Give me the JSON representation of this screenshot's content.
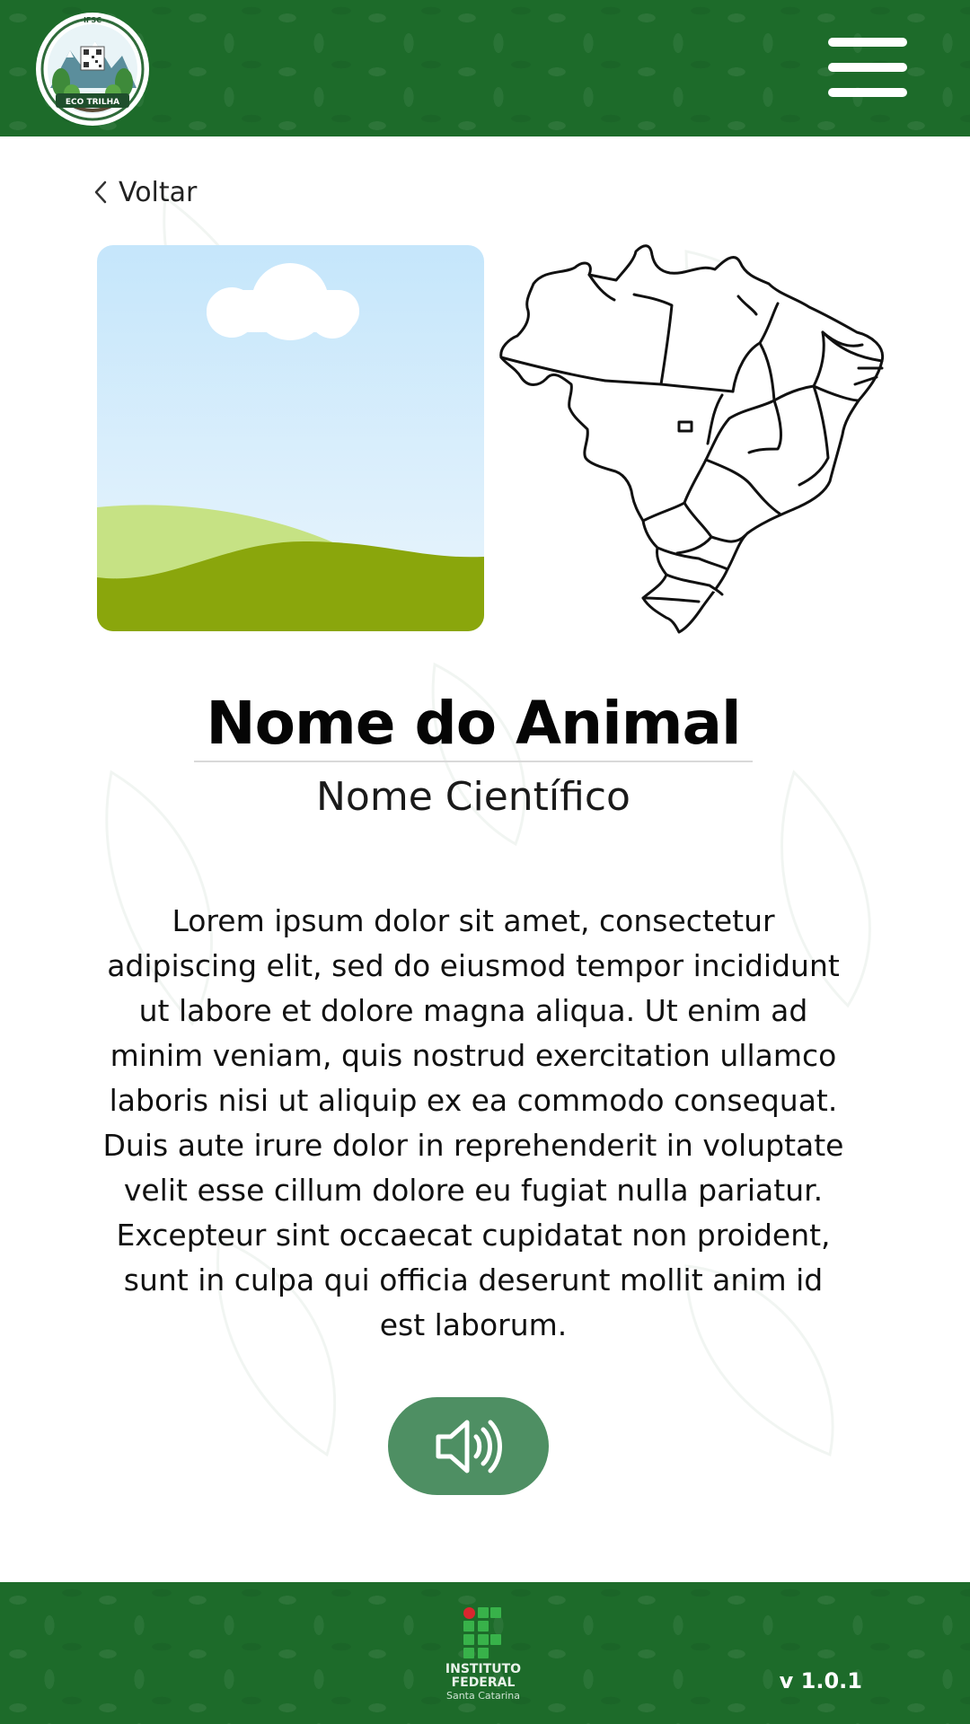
{
  "header": {
    "logo": {
      "top_text": "IFSC",
      "ribbon_text": "ECO TRILHA"
    },
    "menu_icon": "hamburger-menu-icon",
    "background_color": "#1d6b2a"
  },
  "navigation": {
    "back_label": "Voltar",
    "back_icon": "chevron-left-icon"
  },
  "media": {
    "photo_icon": "landscape-placeholder-image",
    "map_icon": "brazil-map-outline"
  },
  "animal": {
    "name": "Nome do Animal",
    "scientific_name": "Nome Científico",
    "description": "Lorem ipsum dolor sit amet, consectetur adipiscing elit, sed do eiusmod tempor incididunt ut labore et dolore magna aliqua. Ut enim ad minim veniam, quis nostrud exercitation ullamco laboris nisi ut aliquip ex ea commodo consequat. Duis aute irure dolor in reprehenderit in voluptate velit esse cillum dolore eu fugiat nulla pariatur. Excepteur sint occaecat cupidatat non proident, sunt in culpa qui officia deserunt mollit anim id est laborum."
  },
  "audio": {
    "icon": "speaker-volume-icon",
    "button_color": "#4e8f63"
  },
  "footer": {
    "institute_line1": "INSTITUTO",
    "institute_line2": "FEDERAL",
    "institute_line3": "Santa Catarina",
    "version": "v 1.0.1",
    "background_color": "#1d6b2a"
  }
}
